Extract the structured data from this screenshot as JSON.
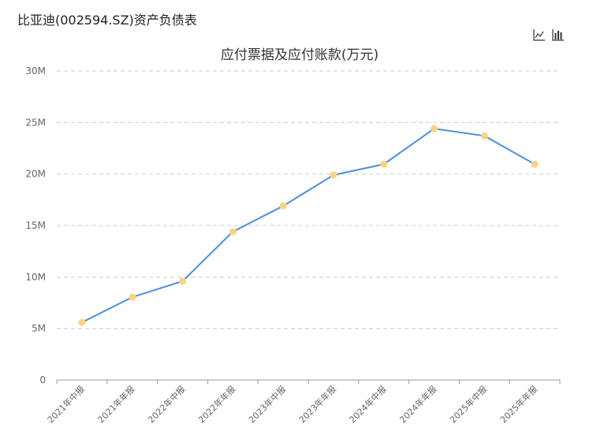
{
  "page": {
    "title": "比亚迪(002594.SZ)资产负债表"
  },
  "toolbar": {
    "line_icon": "line-chart-icon",
    "bar_icon": "bar-chart-icon"
  },
  "chart_data": {
    "type": "line",
    "title": "应付票据及应付账款(万元)",
    "categories": [
      "2021年中报",
      "2021年年报",
      "2022年中报",
      "2022年年报",
      "2023年中报",
      "2023年年报",
      "2024年中报",
      "2024年年报",
      "2025年中报",
      "2025年年报"
    ],
    "series": [
      {
        "values": [
          5.6,
          8.05,
          9.6,
          14.4,
          16.9,
          19.9,
          20.95,
          24.4,
          23.7,
          20.95
        ],
        "color": "#4a90e2",
        "marker_color": "#fbd47d"
      }
    ],
    "yticks": [
      "0",
      "5M",
      "10M",
      "15M",
      "20M",
      "25M",
      "30M"
    ],
    "ylim": [
      0,
      30
    ],
    "grid": true,
    "legend": "none"
  }
}
